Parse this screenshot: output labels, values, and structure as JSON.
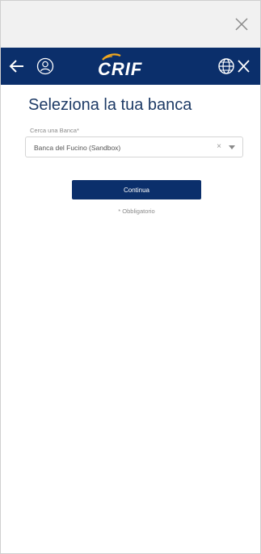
{
  "window": {
    "close_icon": "close-icon"
  },
  "navbar": {
    "background": "#0b2f6b",
    "back_icon": "arrow-left-icon",
    "avatar_icon": "user-avatar-icon",
    "logo_text": "CRIF",
    "language_icon": "globe-icon",
    "close_icon": "close-icon"
  },
  "main": {
    "title": "Seleziona la tua banca",
    "bank_field": {
      "label": "Cerca una Banca*",
      "value": "Banca del Fucino (Sandbox)",
      "clear_symbol": "×",
      "dropdown_icon": "caret-down-icon"
    },
    "continue_label": "Continua",
    "required_note": "* Obbligatorio"
  },
  "colors": {
    "accent": "#0b2f6b",
    "title": "#1e3b66",
    "topbar": "#f1f1f1"
  }
}
